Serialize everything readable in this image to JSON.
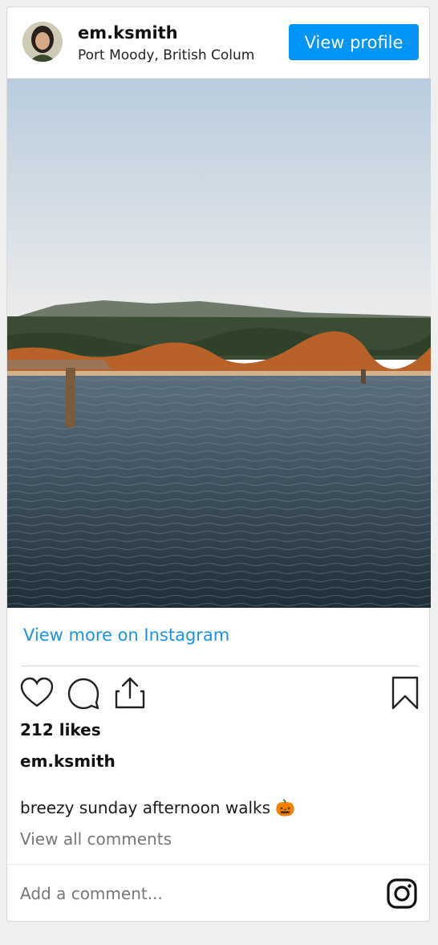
{
  "header": {
    "username": "em.ksmith",
    "location": "Port Moody, British Colum",
    "view_profile_label": "View profile"
  },
  "post": {
    "view_more_label": "View more on Instagram",
    "likes": "212 likes",
    "caption_user": "em.ksmith",
    "caption": "breezy sunday afternoon walks 🎃",
    "view_comments": "View all comments",
    "comment_placeholder": "Add a comment..."
  },
  "colors": {
    "accent": "#0095f6",
    "link": "#1a93e6"
  },
  "icons": [
    "heart-icon",
    "comment-icon",
    "share-icon",
    "bookmark-icon",
    "instagram-icon"
  ]
}
